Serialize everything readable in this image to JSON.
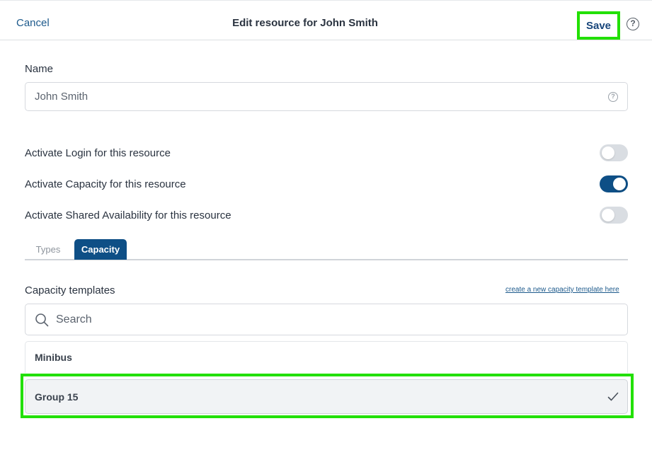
{
  "header": {
    "cancel_label": "Cancel",
    "title": "Edit resource for John Smith",
    "save_label": "Save",
    "help_icon_glyph": "?"
  },
  "name_field": {
    "label": "Name",
    "value": "John Smith",
    "help_icon_glyph": "?"
  },
  "toggles": [
    {
      "label": "Activate Login for this resource",
      "on": false
    },
    {
      "label": "Activate Capacity for this resource",
      "on": true
    },
    {
      "label": "Activate Shared Availability for this resource",
      "on": false
    }
  ],
  "tabs": [
    {
      "label": "Types",
      "active": false
    },
    {
      "label": "Capacity",
      "active": true
    }
  ],
  "capacity": {
    "section_label": "Capacity templates",
    "create_link": "create a new capacity template here",
    "search_placeholder": "Search",
    "items": [
      {
        "label": "Minibus",
        "selected": false
      },
      {
        "label": "Group 15",
        "selected": true
      }
    ]
  },
  "colors": {
    "accent": "#0e4f86",
    "link": "#1d5a8c",
    "highlight": "#22e000",
    "toggle_off": "#d9dde2"
  },
  "icons": [
    "help-icon",
    "search-icon",
    "check-icon"
  ]
}
